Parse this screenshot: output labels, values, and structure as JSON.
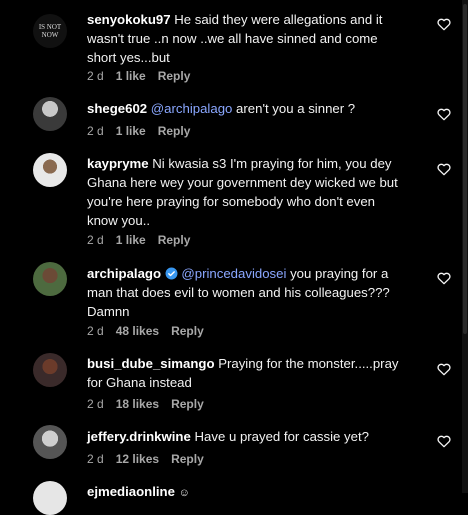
{
  "comments": [
    {
      "username": "senyokoku97",
      "mention": "",
      "text": "He said they were allegations and it wasn't true ..n now ..we all have sinned and come short yes...but",
      "time": "2 d",
      "likes": "1 like",
      "reply": "Reply"
    },
    {
      "username": "shege602",
      "mention": "@archipalago",
      "text": "aren't you a sinner ?",
      "time": "2 d",
      "likes": "1 like",
      "reply": "Reply"
    },
    {
      "username": "kaypryme",
      "mention": "",
      "text": "Ni kwasia s3 I'm praying for him, you dey Ghana here wey your government dey wicked we but you're here praying for somebody who don't even know you..",
      "time": "2 d",
      "likes": "1 like",
      "reply": "Reply"
    },
    {
      "username": "archipalago",
      "mention": "@princedavidosei",
      "text": "you praying for a man that does evil to women and his colleagues??? Damnn",
      "time": "2 d",
      "likes": "48 likes",
      "reply": "Reply"
    },
    {
      "username": "busi_dube_simango",
      "mention": "",
      "text": "Praying for the monster.....pray for Ghana instead",
      "time": "2 d",
      "likes": "18 likes",
      "reply": "Reply"
    },
    {
      "username": "jeffery.drinkwine",
      "mention": "",
      "text": "Have u prayed for cassie yet?",
      "time": "2 d",
      "likes": "12 likes",
      "reply": "Reply"
    },
    {
      "username": "ejmediaonline",
      "mention": "",
      "text": "",
      "time": "",
      "likes": "",
      "reply": ""
    }
  ],
  "avatars": {
    "first_avatar_text": "IS NOT NOW"
  },
  "colors": {
    "background": "#000000",
    "mention": "#8aa7ff",
    "verified": "#3897f0",
    "muted": "#a8a8a8"
  }
}
